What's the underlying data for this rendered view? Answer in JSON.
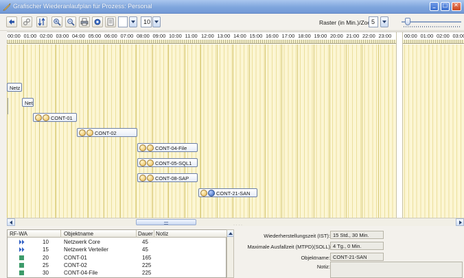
{
  "window": {
    "title": "Grafischer Wiederanlaufplan für Prozess: Personal"
  },
  "toolbar": {
    "zoom_level_value": "10",
    "raster_label": "Raster (in Min.)/Zoom",
    "raster_value": "5"
  },
  "timeline": {
    "hours": [
      "00:00",
      "01:00",
      "02:00",
      "03:00",
      "04:00",
      "05:00",
      "06:00",
      "07:00",
      "08:00",
      "09:00",
      "10:00",
      "11:00",
      "12:00",
      "13:00",
      "14:00",
      "15:00",
      "16:00",
      "17:00",
      "18:00",
      "19:00",
      "20:00",
      "21:00",
      "22:00",
      "23:00"
    ],
    "next_day_hours": [
      "00:00",
      "01:00",
      "02:00",
      "03:00"
    ]
  },
  "gantt_bars": [
    {
      "label": "Netz",
      "icons": []
    },
    {
      "label": "Netz",
      "icons": []
    },
    {
      "label": "CONT-01",
      "icons": [
        "clock-icon",
        "status-icon"
      ]
    },
    {
      "label": "CONT-02",
      "icons": [
        "clock-icon",
        "status-icon"
      ]
    },
    {
      "label": "CONT-04-File",
      "icons": [
        "clock-icon",
        "status-icon"
      ]
    },
    {
      "label": "CONT-05-SQL1",
      "icons": [
        "clock-icon",
        "status-icon"
      ]
    },
    {
      "label": "CONT-08-SAP",
      "icons": [
        "clock-icon",
        "status-icon"
      ]
    },
    {
      "label": "CONT-21-SAN",
      "icons": [
        "clock-icon",
        "info-icon"
      ]
    }
  ],
  "table": {
    "headers": {
      "rfwa": "RF-WA",
      "objektname": "Objektname",
      "dauer": "Dauer",
      "notiz": "Notiz"
    },
    "rows": [
      {
        "rfwa": "10",
        "objektname": "Netzwerk Core",
        "dauer": "45",
        "indicator": "arrow"
      },
      {
        "rfwa": "15",
        "objektname": "Netzwerk Verteiler",
        "dauer": "45",
        "indicator": "arrow"
      },
      {
        "rfwa": "20",
        "objektname": "CONT-01",
        "dauer": "165",
        "indicator": "square"
      },
      {
        "rfwa": "25",
        "objektname": "CONT-02",
        "dauer": "225",
        "indicator": "square"
      },
      {
        "rfwa": "30",
        "objektname": "CONT-04-File",
        "dauer": "225",
        "indicator": "square"
      }
    ]
  },
  "details": {
    "ist_label": "Wiederherstellungszeit (IST):",
    "ist_value": "15 Std., 30 Min.",
    "mtpd_label": "Maximale Ausfallzeit (MTPD)(SOLL)",
    "mtpd_value": "4 Tg., 0 Min.",
    "objektname_label": "Objektname:",
    "objektname_value": "CONT-21-SAN",
    "notiz_label": "Notiz:"
  },
  "colors": {
    "titlebar": "#7fa6dd",
    "plot_background": "#fcf6d4",
    "indicator_arrow": "#2f5fc4",
    "indicator_square": "#3d9b6a"
  }
}
